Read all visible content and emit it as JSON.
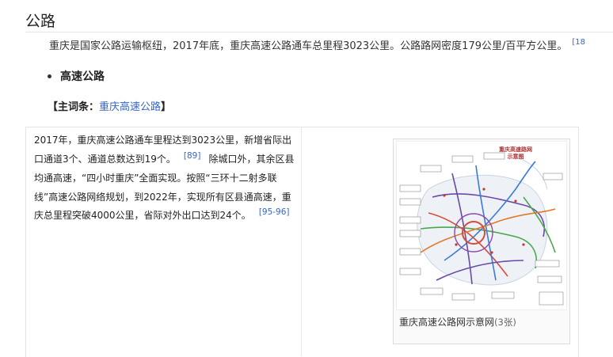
{
  "section": {
    "title": "公路",
    "paragraph": "重庆是国家公路运输枢纽，2017年底，重庆高速公路通车总里程3023公里。公路路网密度179公里/百平方公里。",
    "ref": "[18"
  },
  "subsection": {
    "title": "高速公路",
    "main_entry_prefix": "【主词条：",
    "main_entry_link": "重庆高速公路",
    "main_entry_suffix": "】"
  },
  "card": {
    "text_part1": "2017年，重庆高速公路通车里程达到3023公里，新增省际出口通道3个、通道总数达到19个。",
    "ref1": "[89]",
    "text_part2": "除城口外，其余区县均通高速，“四小时重庆”全面实现。按照“三环十二射多联线”高速公路网络规划，到2022年，实现所有区县通高速，重庆总里程突破4000公里，省际对外出口达到24个。",
    "ref2": "[95-96]",
    "figure": {
      "map_title_line1": "重庆高速路网",
      "map_title_line2": "示意图",
      "caption": "重庆高速公路网示意网",
      "count": "(3张)"
    }
  },
  "colors": {
    "link": "#3366cc",
    "map_red": "#d94a3a",
    "map_purple": "#6a4aa8",
    "map_green": "#4aa84a",
    "map_blue": "#3a7ad9"
  }
}
